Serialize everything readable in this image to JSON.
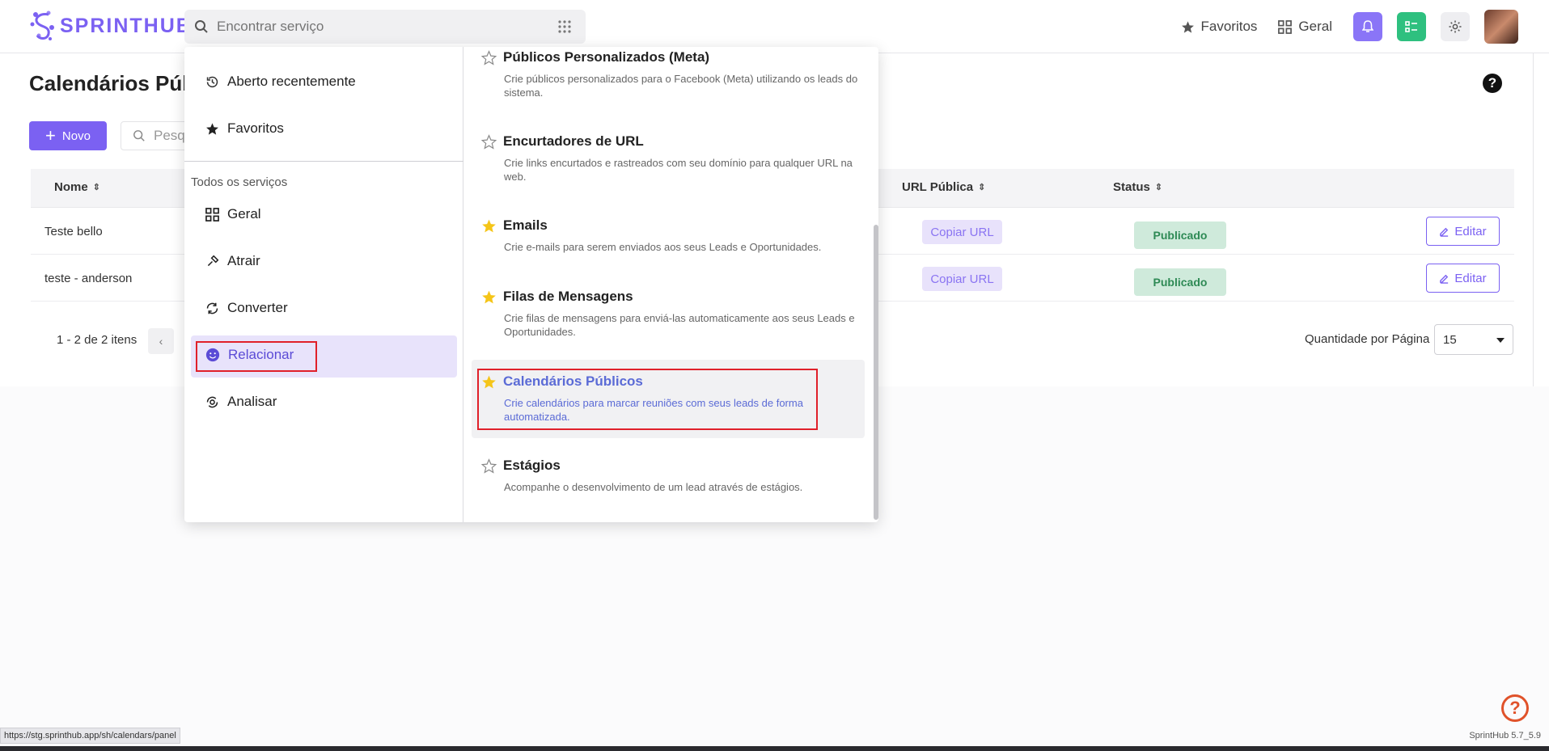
{
  "header": {
    "logo_text": "SPRINTHUB",
    "search_placeholder": "Encontrar serviço",
    "favorites_label": "Favoritos",
    "general_label": "Geral"
  },
  "page": {
    "title": "Calendários Púb",
    "new_button": "Novo",
    "search_placeholder": "Pesq",
    "help_glyph": "?"
  },
  "table": {
    "columns": {
      "name": "Nome",
      "public_url": "URL Pública",
      "status": "Status"
    },
    "rows": [
      {
        "name": "Teste bello",
        "copy_label": "Copiar URL",
        "status": "Publicado",
        "edit_label": "Editar"
      },
      {
        "name": "teste - anderson",
        "copy_label": "Copiar URL",
        "status": "Publicado",
        "edit_label": "Editar"
      }
    ]
  },
  "pager": {
    "summary": "1 - 2 de 2 itens",
    "per_page_label": "Quantidade por Página",
    "per_page_value": "15"
  },
  "dropdown": {
    "recent": "Aberto recentemente",
    "favorites": "Favoritos",
    "section_label": "Todos os serviços",
    "categories": [
      "Geral",
      "Atrair",
      "Converter",
      "Relacionar",
      "Analisar"
    ],
    "active_category": "Relacionar",
    "services": [
      {
        "title": "Públicos Personalizados (Meta)",
        "desc": "Crie públicos personalizados para o Facebook (Meta) utilizando os leads do sistema.",
        "starred": false
      },
      {
        "title": "Encurtadores de URL",
        "desc": "Crie links encurtados e rastreados com seu domínio para qualquer URL na web.",
        "starred": false
      },
      {
        "title": "Emails",
        "desc": "Crie e-mails para serem enviados aos seus Leads e Oportunidades.",
        "starred": true
      },
      {
        "title": "Filas de Mensagens",
        "desc": "Crie filas de mensagens para enviá-las automaticamente aos seus Leads e Oportunidades.",
        "starred": true
      },
      {
        "title": "Calendários Públicos",
        "desc": "Crie calendários para marcar reuniões com seus leads de forma automatizada.",
        "starred": true
      },
      {
        "title": "Estágios",
        "desc": "Acompanhe o desenvolvimento de um lead através de estágios.",
        "starred": false
      }
    ]
  },
  "footer": {
    "status_url": "https://stg.sprinthub.app/sh/calendars/panel",
    "version": "SprintHub 5.7_5.9",
    "help_glyph": "?"
  },
  "colors": {
    "accent": "#7b61f2",
    "success_bg": "#cfeadb",
    "highlight_outline": "#e0202a",
    "star_filled": "#f5c518"
  }
}
